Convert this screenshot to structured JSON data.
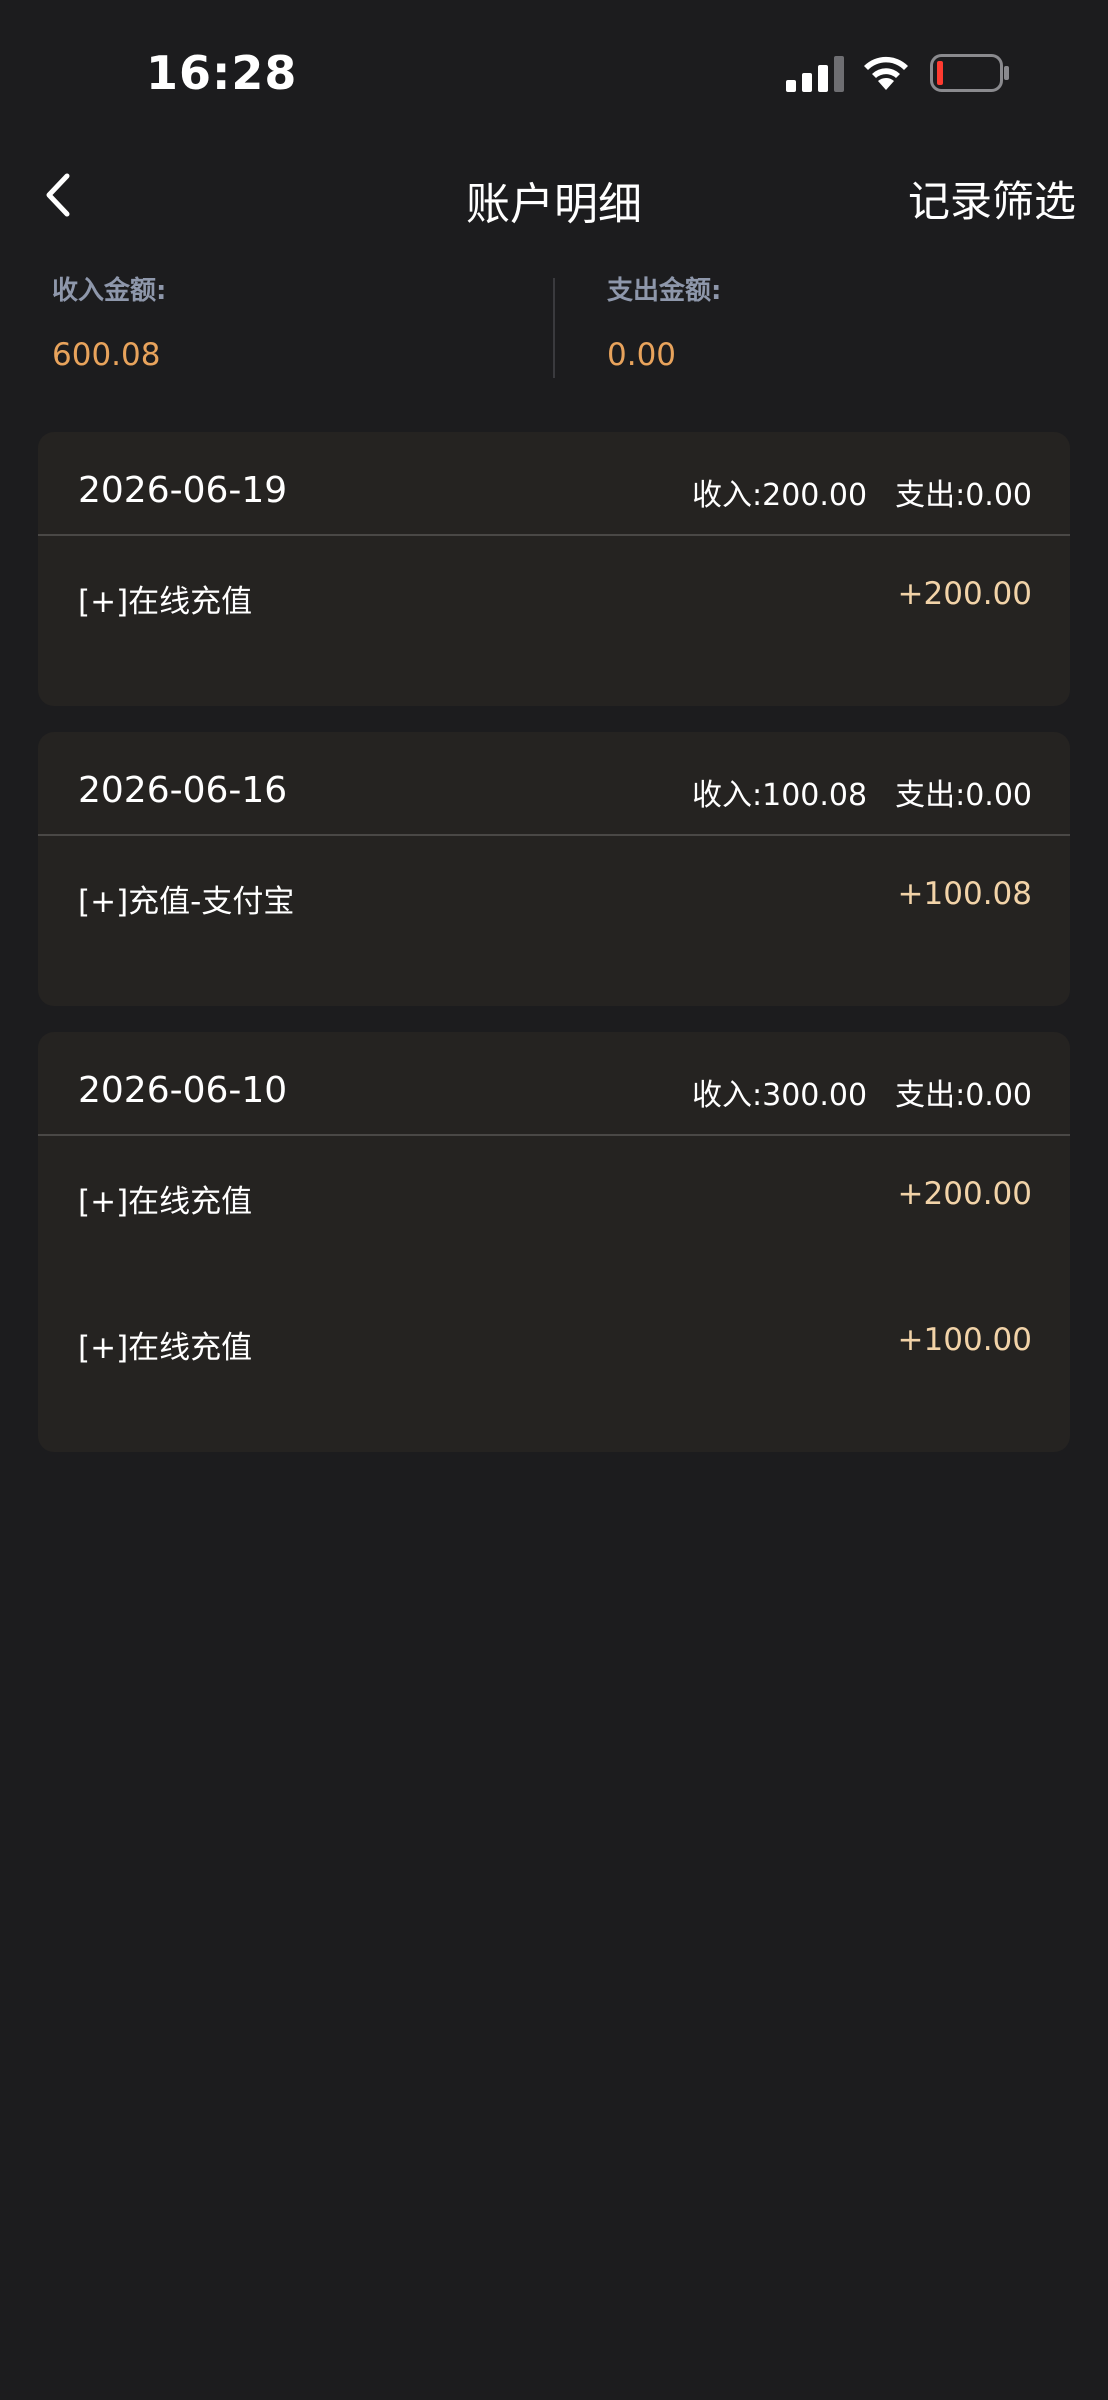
{
  "status_bar": {
    "time": "16:28",
    "icons": [
      "signal-icon",
      "wifi-icon",
      "battery-low-icon"
    ]
  },
  "nav": {
    "back_icon": "chevron-left-icon",
    "title": "账户明细",
    "filter_label": "记录筛选"
  },
  "summary": {
    "income_label": "收入金额:",
    "income_value": "600.08",
    "expense_label": "支出金额:",
    "expense_value": "0.00"
  },
  "days": [
    {
      "date": "2026-06-19",
      "income": "收入:200.00",
      "expense": "支出:0.00",
      "entries": [
        {
          "label": "[+]在线充值",
          "amount": "+200.00"
        }
      ]
    },
    {
      "date": "2026-06-16",
      "income": "收入:100.08",
      "expense": "支出:0.00",
      "entries": [
        {
          "label": "[+]充值-支付宝",
          "amount": "+100.08"
        }
      ]
    },
    {
      "date": "2026-06-10",
      "income": "收入:300.00",
      "expense": "支出:0.00",
      "entries": [
        {
          "label": "[+]在线充值",
          "amount": "+200.00"
        },
        {
          "label": "[+]在线充值",
          "amount": "+100.00"
        }
      ]
    }
  ],
  "colors": {
    "background": "#1c1c1e",
    "card": "#252321",
    "summary_value": "#e8a35c",
    "entry_amount": "#f2d3a8",
    "label_muted": "#8e97ab"
  }
}
